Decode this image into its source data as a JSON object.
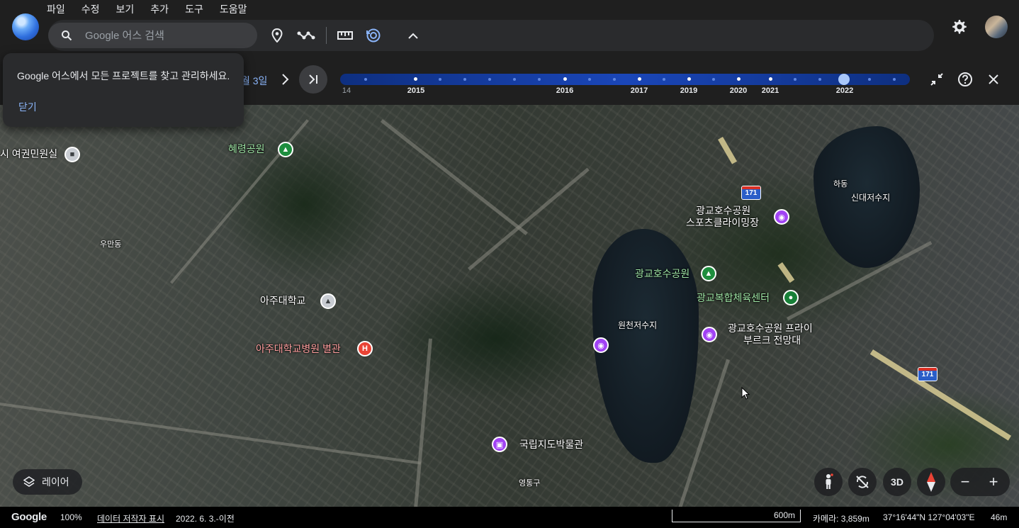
{
  "menu": [
    "파일",
    "수정",
    "보기",
    "추가",
    "도구",
    "도움말"
  ],
  "search": {
    "placeholder": "Google 어스 검색"
  },
  "popup": {
    "message": "Google 어스에서 모든 프로젝트를 찾고 관리하세요.",
    "close_label": "닫기"
  },
  "timeline": {
    "date_label": "월 3일",
    "start_fragment": "14",
    "years": [
      "2015",
      "2016",
      "2017",
      "2019",
      "2020",
      "2021",
      "2022"
    ],
    "selected_year": "2022"
  },
  "map_labels": {
    "hyeryeong_park": "혜령공원",
    "women_center": "시 여권민원실",
    "umandong": "우만동",
    "ajou_univ": "아주대학교",
    "ajou_hospital": "아주대학교병원 별관",
    "national_map_museum": "국립지도박물관",
    "yeongtong": "영통구",
    "wonchun_reservoir": "원천저수지",
    "gwanggyo_park": "광교호수공원",
    "gwanggyo_climbing_line1": "광교호수공원",
    "gwanggyo_climbing_line2": "스포츠클라이밍장",
    "gwanggyo_sports": "광교복합체육센터",
    "gwanggyo_freiburg_line1": "광교호수공원 프라이",
    "gwanggyo_freiburg_line2": "부르크 전망대",
    "hadong": "하동",
    "sindae_reservoir": "신대저수지",
    "route_171": "171",
    "hospital_letter": "H"
  },
  "controls": {
    "layers_label": "레이어",
    "three_d_label": "3D",
    "zoom_out": "−",
    "zoom_in": "+"
  },
  "status": {
    "brand": "Google",
    "zoom_percent": "100%",
    "data_attribution": "데이터 저작자 표시",
    "imagery_date": "2022. 6. 3.-이전",
    "scale": "600m",
    "camera": "카메라: 3,859m",
    "coordinates": "37°16'44\"N 127°04'03\"E",
    "elevation": "46m"
  },
  "colors": {
    "accent": "#8ab4f8",
    "timeline_track": "#1a46b8",
    "park_pin": "#1e8e3e",
    "poi_pin": "#a142f4",
    "hospital_pin": "#ea4335"
  }
}
